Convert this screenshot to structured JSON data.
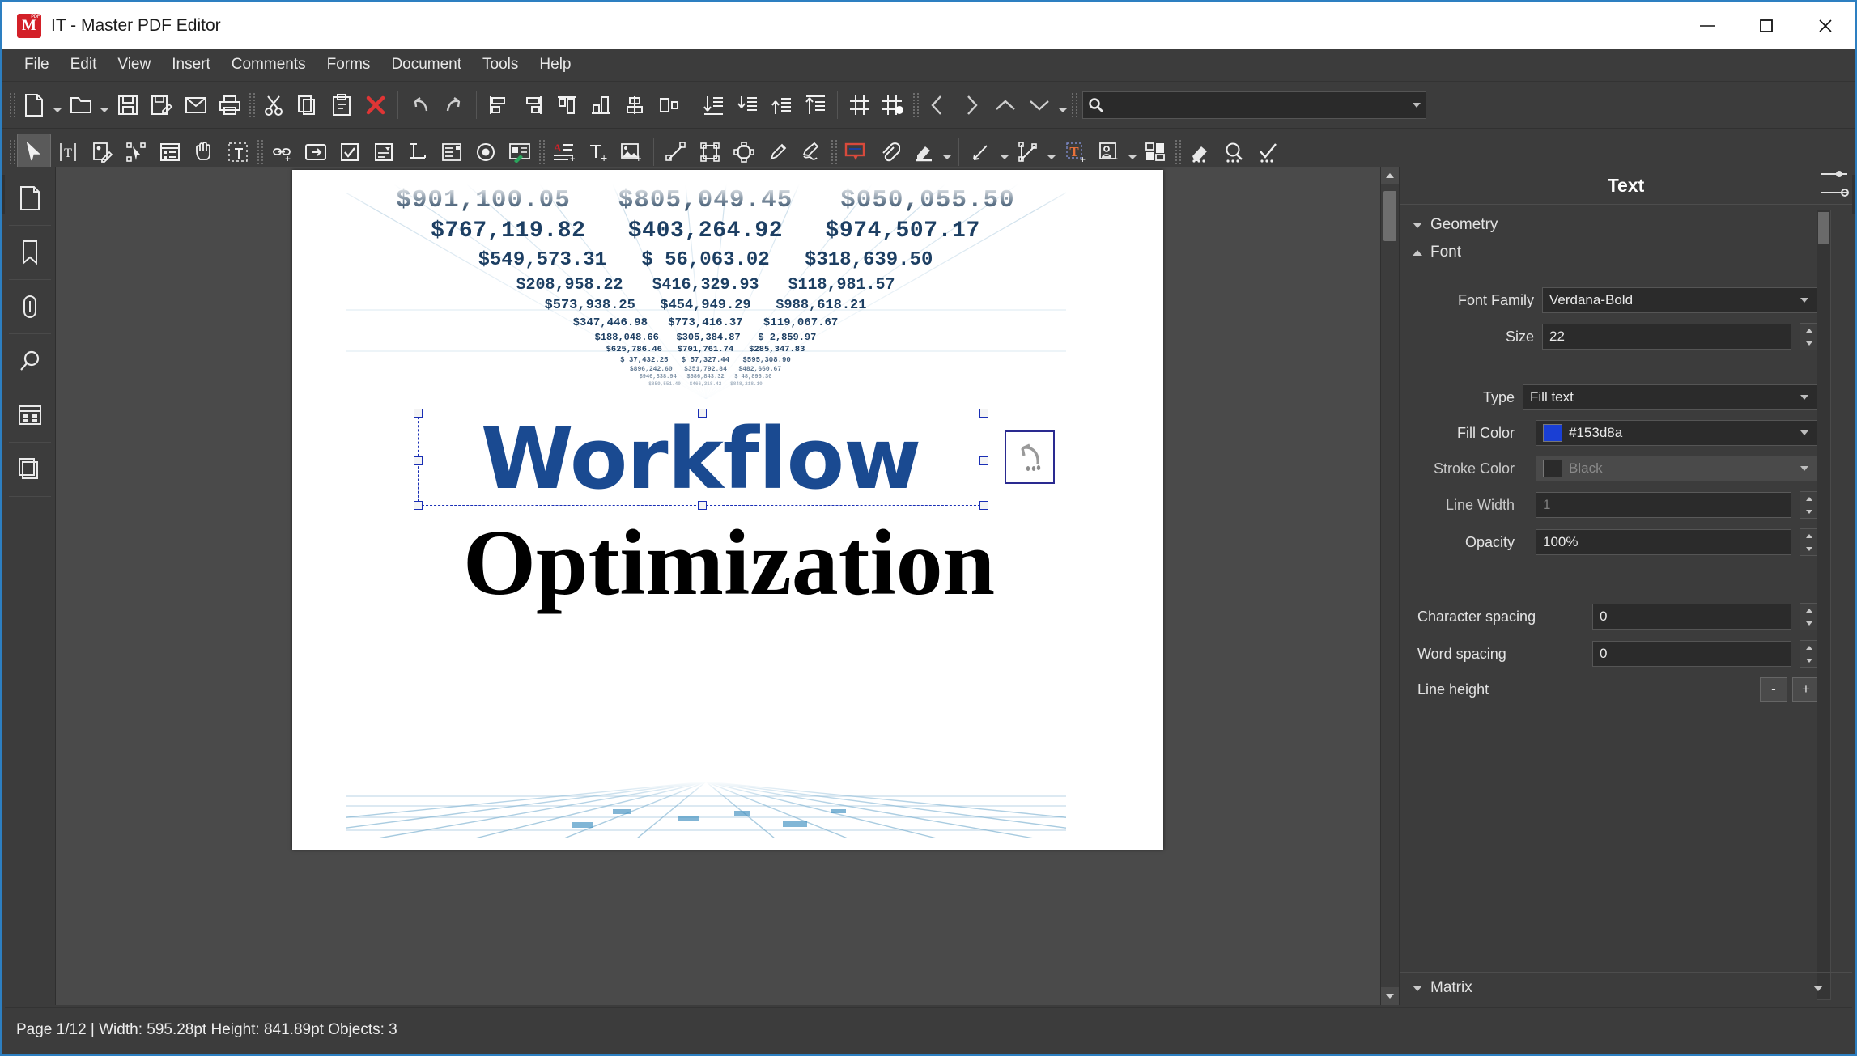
{
  "window": {
    "title": "IT - Master PDF Editor",
    "logo_text": "M",
    "logo_badge": "PDF",
    "minimize_label": "Minimize",
    "maximize_label": "Maximize",
    "close_label": "Close"
  },
  "menubar": {
    "items": [
      "File",
      "Edit",
      "View",
      "Insert",
      "Comments",
      "Forms",
      "Document",
      "Tools",
      "Help"
    ]
  },
  "toolbar_main": {
    "items": [
      {
        "name": "new-document-icon",
        "tip": "New"
      },
      {
        "name": "open-document-icon",
        "tip": "Open"
      },
      {
        "name": "save-icon",
        "tip": "Save"
      },
      {
        "name": "save-as-icon",
        "tip": "Save As"
      },
      {
        "name": "email-icon",
        "tip": "Email"
      },
      {
        "name": "print-icon",
        "tip": "Print"
      },
      {
        "name": "cut-icon",
        "tip": "Cut"
      },
      {
        "name": "copy-icon",
        "tip": "Copy"
      },
      {
        "name": "paste-icon",
        "tip": "Paste"
      },
      {
        "name": "delete-icon",
        "tip": "Delete"
      },
      {
        "name": "undo-icon",
        "tip": "Undo"
      },
      {
        "name": "redo-icon",
        "tip": "Redo"
      },
      {
        "name": "align-left-icon",
        "tip": "Align Left"
      },
      {
        "name": "align-right-icon",
        "tip": "Align Right"
      },
      {
        "name": "align-top-icon",
        "tip": "Align Top"
      },
      {
        "name": "align-bottom-icon",
        "tip": "Align Bottom"
      },
      {
        "name": "align-center-vertical-icon",
        "tip": "Center Vertically"
      },
      {
        "name": "distribute-horizontal-icon",
        "tip": "Distribute Horizontally"
      },
      {
        "name": "send-to-back-icon",
        "tip": "Send to Back"
      },
      {
        "name": "send-backward-icon",
        "tip": "Send Backward"
      },
      {
        "name": "bring-forward-icon",
        "tip": "Bring Forward"
      },
      {
        "name": "bring-to-front-icon",
        "tip": "Bring to Front"
      },
      {
        "name": "grid-icon",
        "tip": "Show Grid"
      },
      {
        "name": "snap-to-grid-icon",
        "tip": "Snap to Grid"
      },
      {
        "name": "previous-page-icon",
        "tip": "Previous Page"
      },
      {
        "name": "next-page-icon",
        "tip": "Next Page"
      },
      {
        "name": "scroll-up-icon",
        "tip": "Scroll Up"
      },
      {
        "name": "scroll-down-icon",
        "tip": "Scroll Down"
      }
    ],
    "search_placeholder": "",
    "search_value": ""
  },
  "toolbar_tools": {
    "items": [
      {
        "name": "select-tool-icon",
        "tip": "Edit Objects",
        "active": true
      },
      {
        "name": "edit-text-tool-icon",
        "tip": "Edit Text"
      },
      {
        "name": "edit-image-tool-icon",
        "tip": "Edit Image"
      },
      {
        "name": "edit-path-tool-icon",
        "tip": "Edit Path"
      },
      {
        "name": "edit-form-tool-icon",
        "tip": "Edit Forms"
      },
      {
        "name": "hand-tool-icon",
        "tip": "Hand Tool"
      },
      {
        "name": "select-text-tool-icon",
        "tip": "Select Text"
      },
      {
        "name": "link-field-icon",
        "tip": "Link"
      },
      {
        "name": "button-field-icon",
        "tip": "Push Button"
      },
      {
        "name": "checkbox-field-icon",
        "tip": "Check Box"
      },
      {
        "name": "combobox-field-icon",
        "tip": "Combo Box"
      },
      {
        "name": "text-field-icon",
        "tip": "Text Field"
      },
      {
        "name": "listbox-field-icon",
        "tip": "List Box"
      },
      {
        "name": "radiobutton-field-icon",
        "tip": "Radio Button"
      },
      {
        "name": "signature-field-icon",
        "tip": "Signature Field"
      },
      {
        "name": "add-text-block-icon",
        "tip": "Add Text"
      },
      {
        "name": "insert-text-icon",
        "tip": "Insert Text"
      },
      {
        "name": "insert-image-icon",
        "tip": "Insert Image"
      },
      {
        "name": "line-shape-icon",
        "tip": "Line"
      },
      {
        "name": "rectangle-shape-icon",
        "tip": "Rectangle"
      },
      {
        "name": "polygon-shape-icon",
        "tip": "Polygon"
      },
      {
        "name": "pencil-icon",
        "tip": "Pencil"
      },
      {
        "name": "freehand-icon",
        "tip": "Freehand"
      },
      {
        "name": "sticky-note-icon",
        "tip": "Sticky Note"
      },
      {
        "name": "attachment-icon",
        "tip": "Attach File"
      },
      {
        "name": "highlighter-icon",
        "tip": "Highlight"
      },
      {
        "name": "measure-line-icon",
        "tip": "Measure"
      },
      {
        "name": "measure-polygon-icon",
        "tip": "Measure Area"
      },
      {
        "name": "add-textbox-icon",
        "tip": "Text Box"
      },
      {
        "name": "add-stamp-icon",
        "tip": "Stamp"
      },
      {
        "name": "layout-icon",
        "tip": "Layout"
      },
      {
        "name": "eraser-icon",
        "tip": "Eraser"
      },
      {
        "name": "zoom-icon",
        "tip": "Zoom"
      },
      {
        "name": "check-mark-icon",
        "tip": "Check Mark"
      }
    ]
  },
  "document_tab": {
    "label": "IT",
    "close_icon": "close-icon"
  },
  "sidebar": {
    "items": [
      {
        "name": "pages-panel-icon",
        "label": "Pages"
      },
      {
        "name": "bookmarks-panel-icon",
        "label": "Bookmarks"
      },
      {
        "name": "attachments-panel-icon",
        "label": "Attachments"
      },
      {
        "name": "search-panel-icon",
        "label": "Search"
      },
      {
        "name": "forms-panel-icon",
        "label": "Forms"
      },
      {
        "name": "layers-panel-icon",
        "label": "Layers"
      }
    ]
  },
  "document": {
    "heading_selected": "Workflow",
    "heading_selected_color": "#1a4a91",
    "heading_second": "Optimization",
    "heading_second_color": "#000000",
    "artwork_rows": [
      [
        "$901,100.05",
        "$805,049.45",
        "$050,055.50"
      ],
      [
        "$767,119.82",
        "$403,264.92",
        "$974,507.17"
      ],
      [
        "$549,573.31",
        "$ 56,063.02",
        "$318,639.50"
      ],
      [
        "$208,958.22",
        "$416,329.93",
        "$118,981.57"
      ],
      [
        "$573,938.25",
        "$454,949.29",
        "$988,618.21"
      ],
      [
        "$347,446.98",
        "$773,416.37",
        "$119,067.67"
      ],
      [
        "$188,048.66",
        "$305,384.87",
        "$  2,859.97"
      ],
      [
        "$625,786.46",
        "$701,761.74",
        "$285,347.83"
      ],
      [
        "$ 37,432.25",
        "$ 57,327.44",
        "$595,308.90"
      ],
      [
        "$896,242.60",
        "$351,792.84",
        "$482,660.67"
      ],
      [
        "$946,338.94",
        "$686,843.32",
        "$ 48,896.30"
      ],
      [
        "$859,551.40",
        "$466,318.42",
        "$848,218.10"
      ]
    ]
  },
  "properties_panel": {
    "title": "Text",
    "sections": {
      "geometry_label": "Geometry",
      "font_label": "Font",
      "matrix_label": "Matrix"
    },
    "fields": {
      "font_family_label": "Font Family",
      "font_family_value": "Verdana-Bold",
      "size_label": "Size",
      "size_value": "22",
      "type_label": "Type",
      "type_value": "Fill text",
      "fill_color_label": "Fill Color",
      "fill_color_value": "#153d8a",
      "fill_color_swatch": "#1a3fd4",
      "stroke_color_label": "Stroke Color",
      "stroke_color_value": "Black",
      "stroke_color_swatch": "#2b2b2b",
      "line_width_label": "Line Width",
      "line_width_value": "1",
      "opacity_label": "Opacity",
      "opacity_value": "100%",
      "character_spacing_label": "Character spacing",
      "character_spacing_value": "0",
      "word_spacing_label": "Word spacing",
      "word_spacing_value": "0",
      "line_height_label": "Line height",
      "line_height_minus": "-",
      "line_height_plus": "+"
    }
  },
  "statusbar": {
    "text": "Page 1/12 | Width: 595.28pt Height: 841.89pt Objects: 3"
  }
}
